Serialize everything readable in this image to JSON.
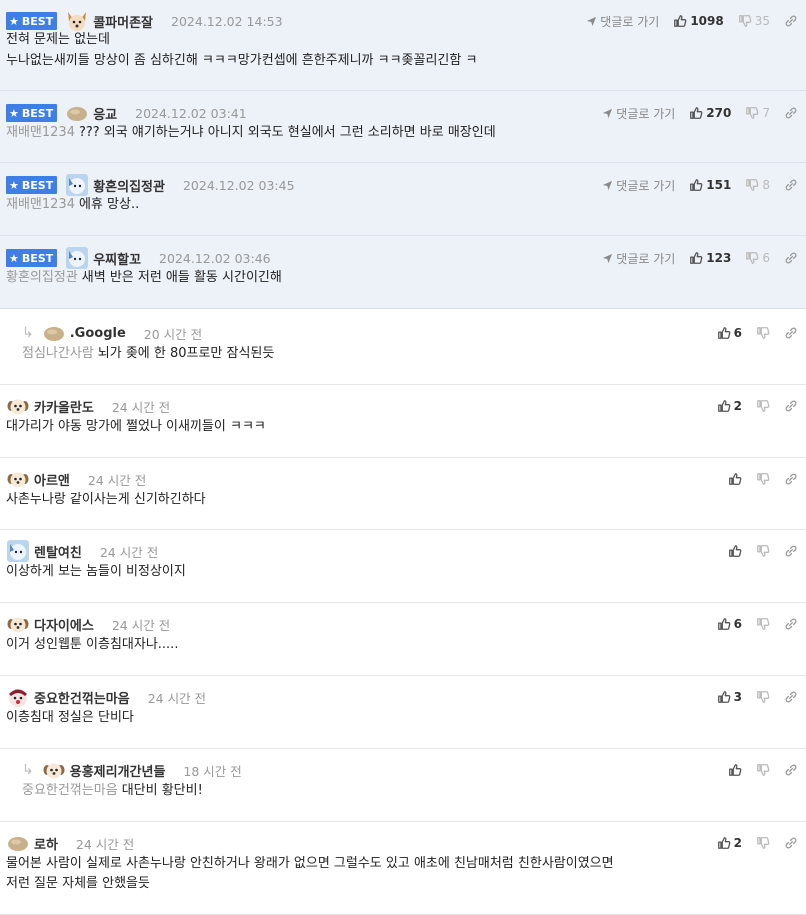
{
  "labels": {
    "best": "BEST",
    "reply_link": "댓글로 가기"
  },
  "comments": [
    {
      "best": true,
      "reply": false,
      "avatar": "dog-avatar",
      "nick": "콜파머존잘",
      "time": "2024.12.02 14:53",
      "likes": "1098",
      "dislikes": "35",
      "mention": "",
      "lines": [
        "전혀 문제는 없는데",
        "누나없는새끼들 망상이 좀 심하긴해 ㅋㅋㅋ망가컨셉에 흔한주제니까 ㅋㅋ좆꼴리긴함 ㅋ"
      ]
    },
    {
      "best": true,
      "reply": false,
      "avatar": "potato-avatar",
      "nick": "응교",
      "time": "2024.12.02 03:41",
      "likes": "270",
      "dislikes": "7",
      "mention": "재배맨1234",
      "lines": [
        "??? 외국 얘기하는거냐 아니지 외국도 현실에서 그런 소리하면 바로 매장인데"
      ]
    },
    {
      "best": true,
      "reply": false,
      "avatar": "bluedog-avatar",
      "nick": "황혼의집정관",
      "time": "2024.12.02 03:45",
      "likes": "151",
      "dislikes": "8",
      "mention": "재배맨1234",
      "lines": [
        "에휴 망상.."
      ]
    },
    {
      "best": true,
      "reply": false,
      "avatar": "bluedog-avatar",
      "nick": "우찌할꼬",
      "time": "2024.12.02 03:46",
      "likes": "123",
      "dislikes": "6",
      "mention": "황혼의집정관",
      "lines": [
        "새벽 반은 저런 애들 활동 시간이긴해"
      ]
    },
    {
      "best": false,
      "reply": true,
      "avatar": "potato-avatar",
      "nick": ".Google",
      "time": "20 시간 전",
      "likes": "6",
      "dislikes": "",
      "mention": "점심나간사람",
      "lines": [
        "뇌가 좆에 한 80프로만 잠식된듯"
      ]
    },
    {
      "best": false,
      "reply": false,
      "avatar": "puppy-avatar",
      "nick": "카카올란도",
      "time": "24 시간 전",
      "likes": "2",
      "dislikes": "",
      "mention": "",
      "lines": [
        "대가리가 야동 망가에 쩔었나 이새끼들이 ㅋㅋㅋ"
      ]
    },
    {
      "best": false,
      "reply": false,
      "avatar": "puppy-avatar",
      "nick": "아르앤",
      "time": "24 시간 전",
      "likes": "",
      "dislikes": "",
      "mention": "",
      "lines": [
        "사촌누나랑 같이사는게 신기하긴하다"
      ]
    },
    {
      "best": false,
      "reply": false,
      "avatar": "bluedog-avatar",
      "nick": "렌탈여친",
      "time": "24 시간 전",
      "likes": "",
      "dislikes": "",
      "mention": "",
      "lines": [
        "이상하게 보는 놈들이 비정상이지"
      ]
    },
    {
      "best": false,
      "reply": false,
      "avatar": "puppy-avatar",
      "nick": "다자이에스",
      "time": "24 시간 전",
      "likes": "6",
      "dislikes": "",
      "mention": "",
      "lines": [
        "이거 성인웹툰 이층침대자나....."
      ]
    },
    {
      "best": false,
      "reply": false,
      "avatar": "clown-avatar",
      "nick": "중요한건꺾는마음",
      "time": "24 시간 전",
      "likes": "3",
      "dislikes": "",
      "mention": "",
      "lines": [
        "이층침대 정실은 단비다"
      ]
    },
    {
      "best": false,
      "reply": true,
      "avatar": "puppy-avatar",
      "nick": "용홍제리개간년들",
      "time": "18 시간 전",
      "likes": "",
      "dislikes": "",
      "mention": "중요한건꺾는마음",
      "lines": [
        "대단비 황단비!"
      ]
    },
    {
      "best": false,
      "reply": false,
      "avatar": "potato-avatar",
      "nick": "로하",
      "time": "24 시간 전",
      "likes": "2",
      "dislikes": "",
      "mention": "",
      "lines": [
        "물어본 사람이 실제로 사촌누나랑 안친하거나 왕래가 없으면 그럴수도 있고 애초에 친남매처럼 친한사람이였으면",
        "저런 질문 자체를 안했을듯"
      ]
    }
  ]
}
